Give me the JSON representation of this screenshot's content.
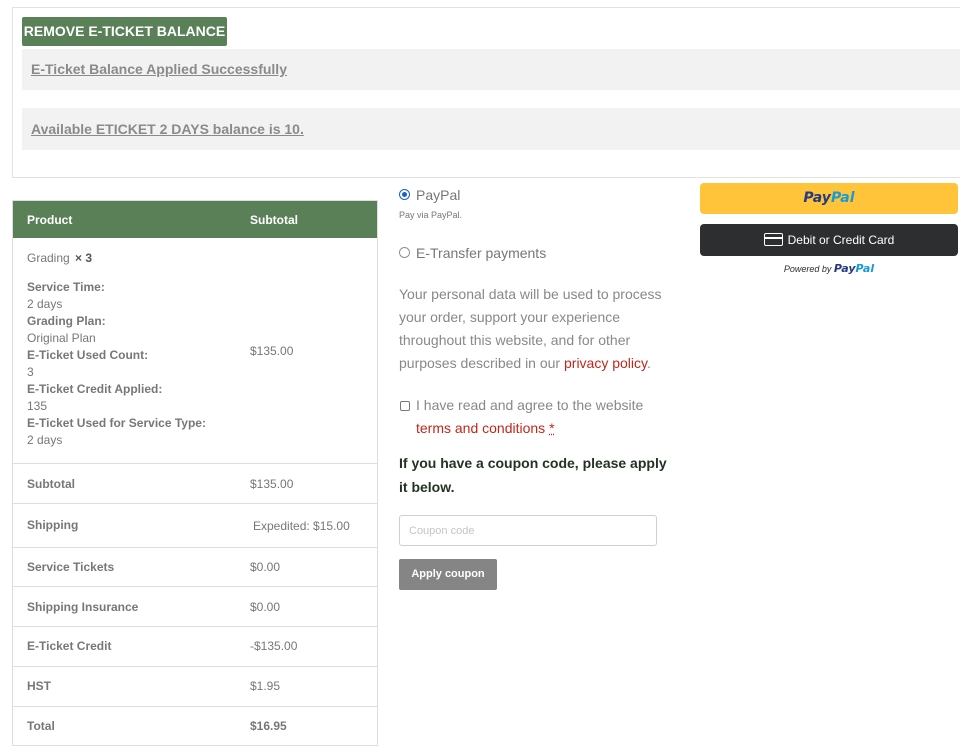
{
  "eticket": {
    "remove_label": "REMOVE E-TICKET BALANCE",
    "applied_notice": "E-Ticket Balance Applied Successfully",
    "balance_notice": "Available ETICKET 2 DAYS balance is 10."
  },
  "order": {
    "headers": {
      "product": "Product",
      "subtotal": "Subtotal"
    },
    "item": {
      "name": "Grading",
      "qty": "× 3",
      "total": "$135.00",
      "meta": [
        {
          "label": "Service Time:",
          "value": "2 days"
        },
        {
          "label": "Grading Plan:",
          "value": "Original Plan"
        },
        {
          "label": "E-Ticket Used Count:",
          "value": "3"
        },
        {
          "label": "E-Ticket Credit Applied:",
          "value": "135"
        },
        {
          "label": "E-Ticket Used for Service Type:",
          "value": "2 days"
        }
      ]
    },
    "rows": [
      {
        "label": "Subtotal",
        "value": "$135.00"
      },
      {
        "label": "Shipping",
        "value": "Expedited: $15.00"
      },
      {
        "label": "Service Tickets",
        "value": "$0.00"
      },
      {
        "label": "Shipping Insurance",
        "value": "$0.00"
      },
      {
        "label": "E-Ticket Credit",
        "value": "-$135.00"
      },
      {
        "label": "HST",
        "value": "$1.95"
      },
      {
        "label": "Total",
        "value": "$16.95"
      }
    ]
  },
  "payment": {
    "paypal_label": "PayPal",
    "paypal_desc": "Pay via PayPal.",
    "etransfer_label": "E-Transfer payments",
    "selected": "PayPal",
    "privacy_text": "Your personal data will be used to process your order, support your experience throughout this website, and for other purposes described in our ",
    "privacy_link": "privacy policy",
    "privacy_end": ".",
    "terms_prefix": "I have read and agree to the website",
    "terms_link": "terms and conditions",
    "terms_required": "*",
    "coupon_hint": "If you have a coupon code, please apply it below.",
    "coupon_placeholder": "Coupon code",
    "coupon_value": "",
    "apply_label": "Apply coupon"
  },
  "paypal_buttons": {
    "paypal_pay": "Pay",
    "paypal_pal": "Pal",
    "card_label": "Debit or Credit Card",
    "powered_by": "Powered by",
    "powered_pay": "Pay",
    "powered_pal": "Pal"
  },
  "colors": {
    "accent_green": "#5a8058",
    "paypal_yellow": "#ffc439",
    "link_red": "#c2261b",
    "apply_gray": "#858585"
  }
}
